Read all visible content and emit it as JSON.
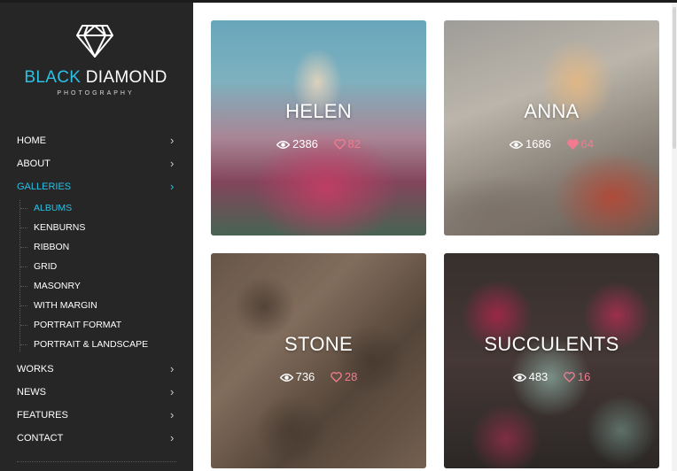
{
  "brand": {
    "name_accent": "BLACK",
    "name_rest": "DIAMOND",
    "tagline": "PHOTOGRAPHY",
    "icon": "diamond-icon",
    "accent_color": "#2bc0e4"
  },
  "nav": {
    "items": [
      {
        "label": "HOME"
      },
      {
        "label": "ABOUT"
      },
      {
        "label": "GALLERIES"
      },
      {
        "label": "WORKS"
      },
      {
        "label": "NEWS"
      },
      {
        "label": "FEATURES"
      },
      {
        "label": "CONTACT"
      }
    ],
    "active": "GALLERIES",
    "galleries_sub": [
      {
        "label": "ALBUMS"
      },
      {
        "label": "KENBURNS"
      },
      {
        "label": "RIBBON"
      },
      {
        "label": "GRID"
      },
      {
        "label": "MASONRY"
      },
      {
        "label": "WITH MARGIN"
      },
      {
        "label": "PORTRAIT FORMAT"
      },
      {
        "label": "PORTRAIT & LANDSCAPE"
      }
    ],
    "active_sub": "ALBUMS"
  },
  "albums": [
    {
      "title": "HELEN",
      "views": "2386",
      "likes": "82",
      "liked": false
    },
    {
      "title": "ANNA",
      "views": "1686",
      "likes": "64",
      "liked": true
    },
    {
      "title": "STONE",
      "views": "736",
      "likes": "28",
      "liked": false
    },
    {
      "title": "SUCCULENTS",
      "views": "483",
      "likes": "16",
      "liked": false
    }
  ],
  "icons": {
    "views": "eye-icon",
    "likes": "heart-icon",
    "chevron": "chevron-right-icon"
  },
  "colors": {
    "sidebar": "#262626",
    "likes": "#f07b90"
  }
}
